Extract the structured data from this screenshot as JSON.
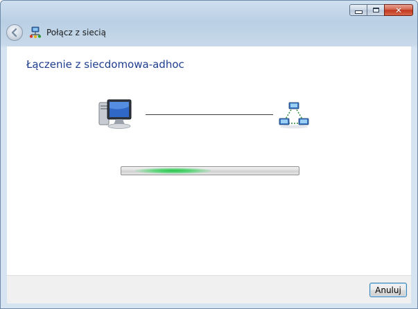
{
  "window": {
    "title": "Połącz z siecią",
    "controls": {
      "minimize_icon": "minimize-icon",
      "maximize_icon": "maximize-icon",
      "close_icon": "close-icon",
      "close_glyph": "✕"
    }
  },
  "navbar": {
    "back_icon": "back-arrow-icon",
    "app_icon": "network-icon",
    "title": "Połącz z siecią"
  },
  "main": {
    "heading": "Łączenie z siecdomowa-adhoc",
    "source_icon": "computer-icon",
    "target_icon": "network-hub-icon"
  },
  "footer": {
    "cancel_label": "Anuluj"
  },
  "colors": {
    "heading": "#1e3d8f",
    "progress_glow": "#26c24a",
    "close_button": "#c1381e"
  }
}
